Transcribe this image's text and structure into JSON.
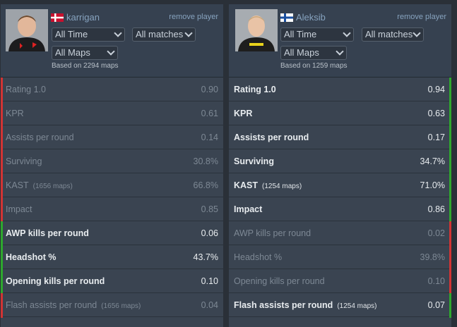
{
  "colors": {
    "better": "#2ea82e",
    "worse": "#d23434"
  },
  "players": [
    {
      "name": "karrigan",
      "flag": "denmark-flag-icon",
      "remove_label": "remove player",
      "filters": {
        "time": "All Time",
        "matches": "All matches",
        "maps": "All Maps"
      },
      "based_on": "Based on 2294 maps",
      "stats": [
        {
          "label": "Rating 1.0",
          "note": "",
          "value": "0.90",
          "state": "worse"
        },
        {
          "label": "KPR",
          "note": "",
          "value": "0.61",
          "state": "worse"
        },
        {
          "label": "Assists per round",
          "note": "",
          "value": "0.14",
          "state": "worse"
        },
        {
          "label": "Surviving",
          "note": "",
          "value": "30.8%",
          "state": "worse"
        },
        {
          "label": "KAST",
          "note": "(1656 maps)",
          "value": "66.8%",
          "state": "worse"
        },
        {
          "label": "Impact",
          "note": "",
          "value": "0.85",
          "state": "worse"
        },
        {
          "label": "AWP kills per round",
          "note": "",
          "value": "0.06",
          "state": "better"
        },
        {
          "label": "Headshot %",
          "note": "",
          "value": "43.7%",
          "state": "better"
        },
        {
          "label": "Opening kills per round",
          "note": "",
          "value": "0.10",
          "state": "better"
        },
        {
          "label": "Flash assists per round",
          "note": "(1656 maps)",
          "value": "0.04",
          "state": "worse"
        }
      ]
    },
    {
      "name": "Aleksib",
      "flag": "finland-flag-icon",
      "remove_label": "remove player",
      "filters": {
        "time": "All Time",
        "matches": "All matches",
        "maps": "All Maps"
      },
      "based_on": "Based on 1259 maps",
      "stats": [
        {
          "label": "Rating 1.0",
          "note": "",
          "value": "0.94",
          "state": "better"
        },
        {
          "label": "KPR",
          "note": "",
          "value": "0.63",
          "state": "better"
        },
        {
          "label": "Assists per round",
          "note": "",
          "value": "0.17",
          "state": "better"
        },
        {
          "label": "Surviving",
          "note": "",
          "value": "34.7%",
          "state": "better"
        },
        {
          "label": "KAST",
          "note": "(1254 maps)",
          "value": "71.0%",
          "state": "better"
        },
        {
          "label": "Impact",
          "note": "",
          "value": "0.86",
          "state": "better"
        },
        {
          "label": "AWP kills per round",
          "note": "",
          "value": "0.02",
          "state": "worse"
        },
        {
          "label": "Headshot %",
          "note": "",
          "value": "39.8%",
          "state": "worse"
        },
        {
          "label": "Opening kills per round",
          "note": "",
          "value": "0.10",
          "state": "worse"
        },
        {
          "label": "Flash assists per round",
          "note": "(1254 maps)",
          "value": "0.07",
          "state": "better"
        }
      ]
    }
  ]
}
